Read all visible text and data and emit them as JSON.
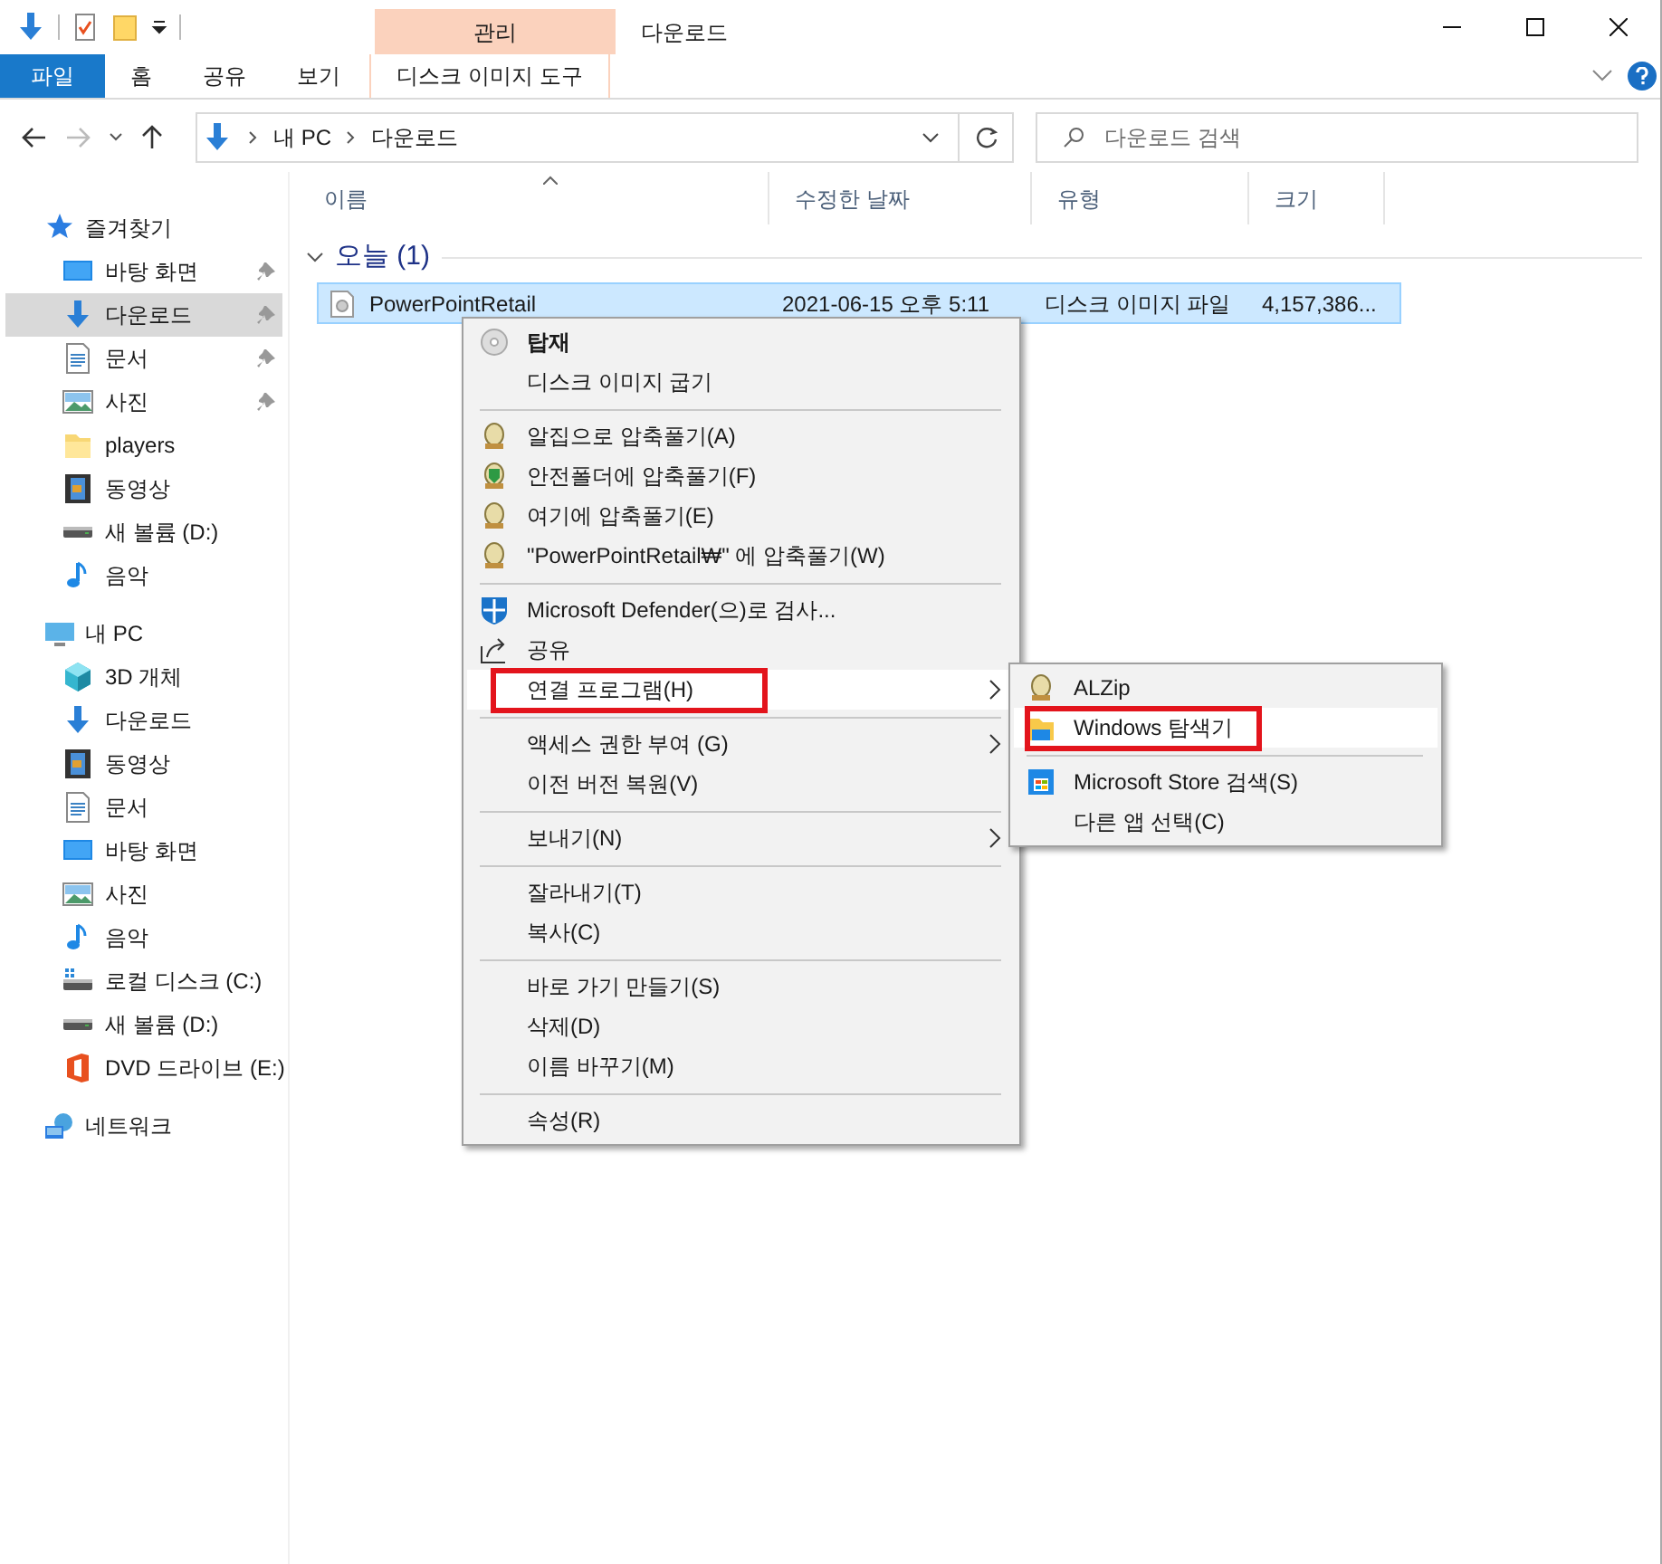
{
  "window": {
    "title": "다운로드"
  },
  "ribbon": {
    "context_group": "관리",
    "tabs": [
      {
        "label": "파일",
        "kind": "file"
      },
      {
        "label": "홈",
        "kind": "normal"
      },
      {
        "label": "공유",
        "kind": "normal"
      },
      {
        "label": "보기",
        "kind": "normal"
      },
      {
        "label": "디스크 이미지 도구",
        "kind": "contextual"
      }
    ]
  },
  "address_bar": {
    "path": [
      "내 PC",
      "다운로드"
    ],
    "search": {
      "placeholder": "다운로드 검색"
    }
  },
  "sidebar": {
    "items": [
      {
        "label": "즐겨찾기",
        "kind": "star",
        "children": [
          {
            "label": "바탕 화면",
            "kind": "desktop",
            "pinned": true,
            "selected": false
          },
          {
            "label": "다운로드",
            "kind": "download",
            "pinned": true,
            "selected": true
          },
          {
            "label": "문서",
            "kind": "document",
            "pinned": true,
            "selected": false
          },
          {
            "label": "사진",
            "kind": "pictures",
            "pinned": true,
            "selected": false
          },
          {
            "label": "players",
            "kind": "folder",
            "pinned": false,
            "selected": false
          },
          {
            "label": "동영상",
            "kind": "videos",
            "pinned": false,
            "selected": false
          },
          {
            "label": "새 볼륨 (D:)",
            "kind": "drive",
            "pinned": false,
            "selected": false
          },
          {
            "label": "음악",
            "kind": "music",
            "pinned": false,
            "selected": false
          }
        ]
      },
      {
        "label": "내 PC",
        "kind": "pc",
        "children": [
          {
            "label": "3D 개체",
            "kind": "cube",
            "pinned": false,
            "selected": false
          },
          {
            "label": "다운로드",
            "kind": "download",
            "pinned": false,
            "selected": false
          },
          {
            "label": "동영상",
            "kind": "videos",
            "pinned": false,
            "selected": false
          },
          {
            "label": "문서",
            "kind": "document",
            "pinned": false,
            "selected": false
          },
          {
            "label": "바탕 화면",
            "kind": "desktop",
            "pinned": false,
            "selected": false
          },
          {
            "label": "사진",
            "kind": "pictures",
            "pinned": false,
            "selected": false
          },
          {
            "label": "음악",
            "kind": "music",
            "pinned": false,
            "selected": false
          },
          {
            "label": "로컬 디스크 (C:)",
            "kind": "system-drive",
            "pinned": false,
            "selected": false
          },
          {
            "label": "새 볼륨 (D:)",
            "kind": "drive",
            "pinned": false,
            "selected": false
          },
          {
            "label": "DVD 드라이브 (E:)",
            "kind": "office",
            "pinned": false,
            "selected": false
          }
        ]
      },
      {
        "label": "네트워크",
        "kind": "network"
      }
    ]
  },
  "file_list": {
    "columns": [
      "이름",
      "수정한 날짜",
      "유형",
      "크기"
    ],
    "group": {
      "label": "오늘 (1)",
      "expanded": true
    },
    "rows": [
      {
        "name": "PowerPointRetail",
        "modified": "2021-06-15 오후 5:11",
        "type": "디스크 이미지 파일",
        "size": "4,157,386...",
        "selected": true
      }
    ]
  },
  "context_menu": {
    "groups": [
      [
        {
          "label": "탑재",
          "kind": "disc",
          "bold": true,
          "submenu": false,
          "selected": false,
          "outlined": false
        },
        {
          "label": "디스크 이미지 굽기",
          "kind": "plain",
          "bold": false,
          "submenu": false,
          "selected": false,
          "outlined": false
        }
      ],
      [
        {
          "label": "알집으로 압축풀기(A)",
          "kind": "egg",
          "bold": false,
          "submenu": false,
          "selected": false,
          "outlined": false
        },
        {
          "label": "안전폴더에 압축풀기(F)",
          "kind": "safe",
          "bold": false,
          "submenu": false,
          "selected": false,
          "outlined": false
        },
        {
          "label": "여기에 압축풀기(E)",
          "kind": "egg",
          "bold": false,
          "submenu": false,
          "selected": false,
          "outlined": false
        },
        {
          "label": "\"PowerPointRetail₩\" 에 압축풀기(W)",
          "kind": "egg",
          "bold": false,
          "submenu": false,
          "selected": false,
          "outlined": false
        }
      ],
      [
        {
          "label": "Microsoft Defender(으)로 검사...",
          "kind": "shield",
          "bold": false,
          "submenu": false,
          "selected": false,
          "outlined": false
        },
        {
          "label": "공유",
          "kind": "share",
          "bold": false,
          "submenu": false,
          "selected": false,
          "outlined": false
        },
        {
          "label": "연결 프로그램(H)",
          "kind": "plain",
          "bold": false,
          "submenu": true,
          "selected": true,
          "outlined": true
        }
      ],
      [
        {
          "label": "액세스 권한 부여 (G)",
          "kind": "plain",
          "bold": false,
          "submenu": true,
          "selected": false,
          "outlined": false
        },
        {
          "label": "이전 버전 복원(V)",
          "kind": "plain",
          "bold": false,
          "submenu": false,
          "selected": false,
          "outlined": false
        }
      ],
      [
        {
          "label": "보내기(N)",
          "kind": "plain",
          "bold": false,
          "submenu": true,
          "selected": false,
          "outlined": false
        }
      ],
      [
        {
          "label": "잘라내기(T)",
          "kind": "plain",
          "bold": false,
          "submenu": false,
          "selected": false,
          "outlined": false
        },
        {
          "label": "복사(C)",
          "kind": "plain",
          "bold": false,
          "submenu": false,
          "selected": false,
          "outlined": false
        }
      ],
      [
        {
          "label": "바로 가기 만들기(S)",
          "kind": "plain",
          "bold": false,
          "submenu": false,
          "selected": false,
          "outlined": false
        },
        {
          "label": "삭제(D)",
          "kind": "plain",
          "bold": false,
          "submenu": false,
          "selected": false,
          "outlined": false
        },
        {
          "label": "이름 바꾸기(M)",
          "kind": "plain",
          "bold": false,
          "submenu": false,
          "selected": false,
          "outlined": false
        }
      ],
      [
        {
          "label": "속성(R)",
          "kind": "plain",
          "bold": false,
          "submenu": false,
          "selected": false,
          "outlined": false
        }
      ]
    ]
  },
  "submenu": {
    "groups": [
      [
        {
          "label": "ALZip",
          "kind": "egg",
          "selected": false,
          "outlined": false
        },
        {
          "label": "Windows 탐색기",
          "kind": "folder",
          "selected": true,
          "outlined": true
        }
      ],
      [
        {
          "label": "Microsoft Store 검색(S)",
          "kind": "store",
          "selected": false,
          "outlined": false
        },
        {
          "label": "다른 앱 선택(C)",
          "kind": "plain",
          "selected": false,
          "outlined": false
        }
      ]
    ]
  }
}
